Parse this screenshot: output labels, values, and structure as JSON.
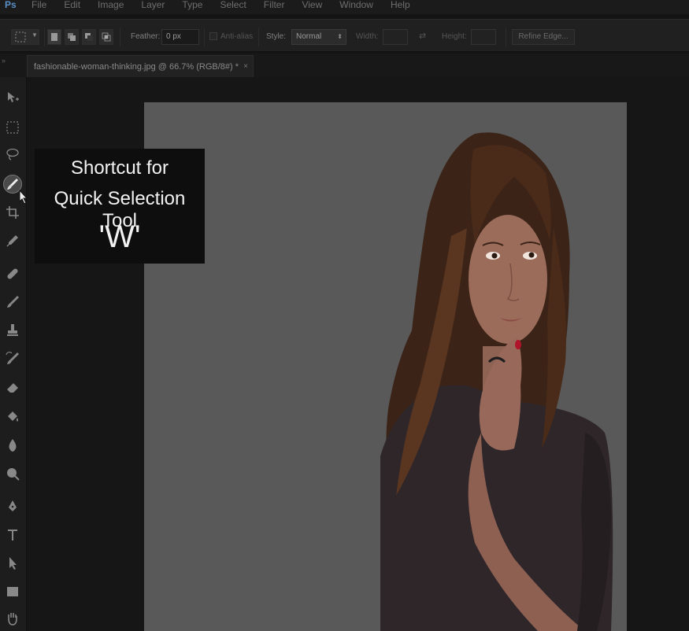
{
  "menu": {
    "logo": "Ps",
    "items": [
      "File",
      "Edit",
      "Image",
      "Layer",
      "Type",
      "Select",
      "Filter",
      "View",
      "Window",
      "Help"
    ]
  },
  "options": {
    "feather_label": "Feather:",
    "feather_value": "0 px",
    "anti_alias_label": "Anti-alias",
    "style_label": "Style:",
    "style_value": "Normal",
    "width_label": "Width:",
    "height_label": "Height:",
    "refine_edge_label": "Refine Edge..."
  },
  "document_tab": {
    "title": "fashionable-woman-thinking.jpg @ 66.7% (RGB/8#) *",
    "close": "×"
  },
  "collapse_glyph": "»",
  "tools": [
    {
      "name": "move-tool",
      "icon": "move-icon"
    },
    {
      "name": "marquee-tool",
      "icon": "rectangular-marquee-icon"
    },
    {
      "name": "lasso-tool",
      "icon": "lasso-icon"
    },
    {
      "name": "quick-selection-tool",
      "icon": "quick-selection-brush-icon",
      "active": true
    },
    {
      "name": "crop-tool",
      "icon": "crop-icon"
    },
    {
      "name": "eyedropper-tool",
      "icon": "eyedropper-icon"
    },
    {
      "name": "healing-brush-tool",
      "icon": "bandage-icon"
    },
    {
      "name": "brush-tool",
      "icon": "brush-icon"
    },
    {
      "name": "clone-stamp-tool",
      "icon": "stamp-icon"
    },
    {
      "name": "history-brush-tool",
      "icon": "history-brush-icon"
    },
    {
      "name": "eraser-tool",
      "icon": "eraser-icon"
    },
    {
      "name": "paint-bucket-tool",
      "icon": "bucket-icon"
    },
    {
      "name": "blur-tool",
      "icon": "drop-icon"
    },
    {
      "name": "dodge-tool",
      "icon": "dodge-icon"
    },
    {
      "name": "pen-tool",
      "icon": "pen-icon"
    },
    {
      "name": "type-tool",
      "icon": "type-icon"
    },
    {
      "name": "path-selection-tool",
      "icon": "arrow-icon"
    },
    {
      "name": "rectangle-tool",
      "icon": "rectangle-icon"
    },
    {
      "name": "hand-tool",
      "icon": "hand-icon"
    }
  ],
  "overlay": {
    "line1": "Shortcut for",
    "line2": "Quick Selection Tool",
    "line3": "'W'"
  }
}
